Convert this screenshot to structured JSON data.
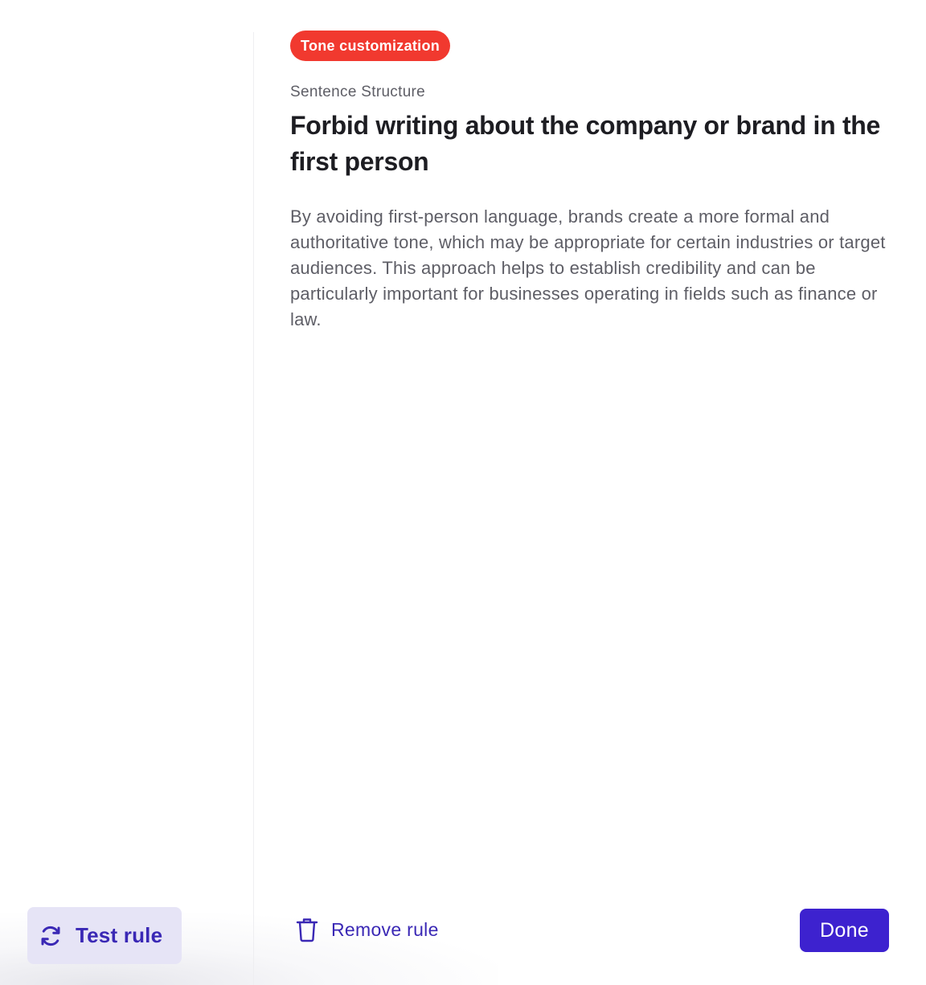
{
  "colors": {
    "accent": "#3d22cf",
    "accent_text": "#3a28b5",
    "badge_bg": "#f1392f",
    "test_button_bg": "#e6e4f6"
  },
  "left_pane": {
    "test_rule": {
      "icon": "refresh-icon",
      "label": "Test rule"
    }
  },
  "rule": {
    "badge": "Tone customization",
    "category": "Sentence Structure",
    "title": "Forbid writing about the company or brand in the first person",
    "description": "By avoiding first-person language, brands create a more formal and authoritative tone, which may be appropriate for certain industries or target audiences. This approach helps to establish credibility and can be particularly important for businesses operating in fields such as finance or law."
  },
  "footer": {
    "remove": {
      "icon": "trash-icon",
      "label": "Remove rule"
    },
    "done_label": "Done"
  }
}
